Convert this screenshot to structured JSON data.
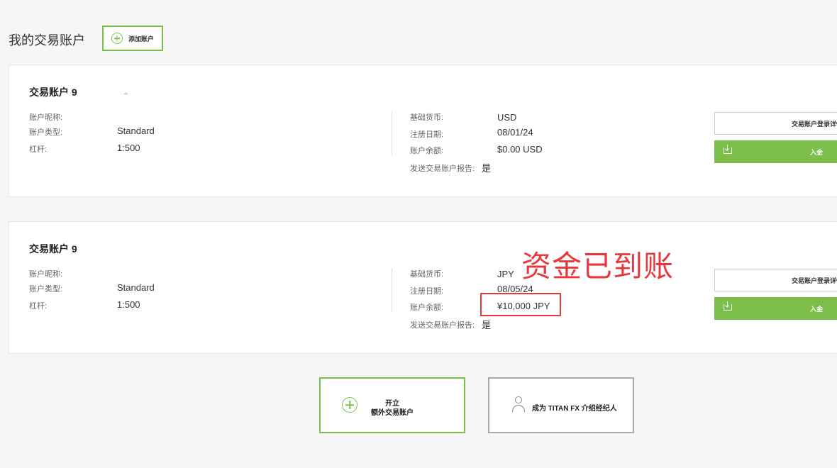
{
  "header": {
    "title": "我的交易账户",
    "add_account_label": "添加账户"
  },
  "accounts": [
    {
      "title": "交易账户 9",
      "fields_left": [
        {
          "label": "账户昵称:",
          "value": ""
        },
        {
          "label": "账户类型:",
          "value": "Standard"
        },
        {
          "label": "杠杆:",
          "value": "1:500"
        }
      ],
      "fields_right": [
        {
          "label": "基础货币:",
          "value": "USD"
        },
        {
          "label": "注册日期:",
          "value": "08/01/24"
        },
        {
          "label": "账户余额:",
          "value": "$0.00 USD"
        },
        {
          "label": "发送交易账户报告:",
          "value": "是"
        }
      ],
      "detail_button": "交易账户登录详情",
      "deposit_button": "入金"
    },
    {
      "title": "交易账户 9",
      "fields_left": [
        {
          "label": "账户昵称:",
          "value": ""
        },
        {
          "label": "账户类型:",
          "value": "Standard"
        },
        {
          "label": "杠杆:",
          "value": "1:500"
        }
      ],
      "fields_right": [
        {
          "label": "基础货币:",
          "value": "JPY"
        },
        {
          "label": "注册日期:",
          "value": "08/05/24"
        },
        {
          "label": "账户余额:",
          "value": "¥10,000 JPY"
        },
        {
          "label": "发送交易账户报告:",
          "value": "是"
        }
      ],
      "detail_button": "交易账户登录详情",
      "deposit_button": "入金"
    }
  ],
  "annotation": {
    "text": "资金已到账",
    "color": "#e8383d"
  },
  "footer_actions": {
    "open_extra_line1": "开立",
    "open_extra_line2": "额外交易账户",
    "become_ib": "成为 TITAN FX 介绍经纪人"
  },
  "colors": {
    "accent_green": "#7bbf4a",
    "background": "#f6f6f6",
    "card": "#ffffff"
  }
}
